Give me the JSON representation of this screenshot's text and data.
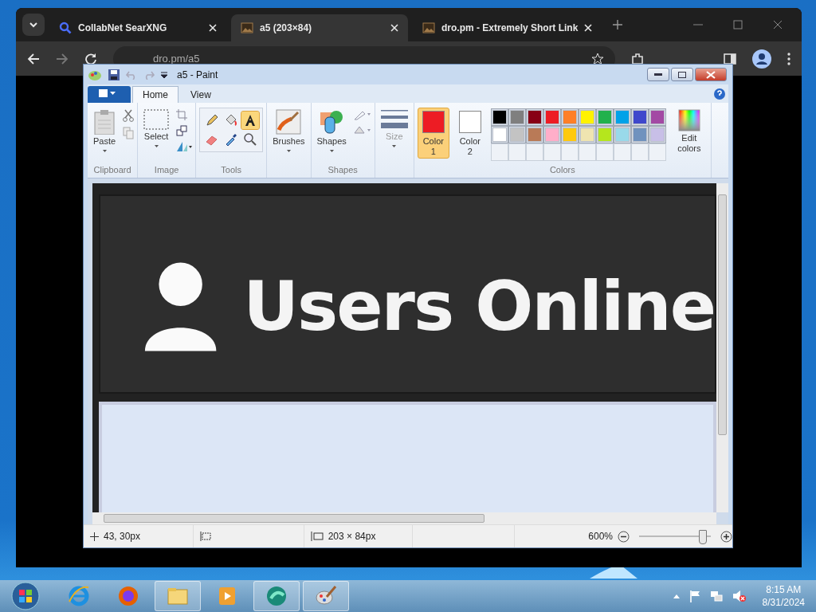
{
  "browser": {
    "tabs": [
      {
        "title": "CollabNet SearXNG",
        "kind": "search",
        "selected": false
      },
      {
        "title": "a5 (203×84)",
        "kind": "image",
        "selected": true
      },
      {
        "title": "dro.pm - Extremely Short Link",
        "kind": "image",
        "selected": false
      }
    ],
    "address": "dro.pm/a5"
  },
  "paint": {
    "title": "a5 - Paint",
    "ribbon_tabs": [
      {
        "label": "Home",
        "selected": true
      },
      {
        "label": "View",
        "selected": false
      }
    ],
    "group_labels": {
      "clipboard": "Clipboard",
      "image": "Image",
      "tools": "Tools",
      "shapes": "Shapes",
      "colors": "Colors"
    },
    "buttons": {
      "paste": "Paste",
      "select": "Select",
      "brushes": "Brushes",
      "shapes": "Shapes",
      "size": "Size",
      "edit_colors": "Edit colors"
    },
    "tools": [
      {
        "kind": "pencil",
        "selected": false
      },
      {
        "kind": "fill",
        "selected": false
      },
      {
        "kind": "text",
        "selected": true
      },
      {
        "kind": "eraser",
        "selected": false
      },
      {
        "kind": "picker",
        "selected": false
      },
      {
        "kind": "magnifier",
        "selected": false
      }
    ],
    "color_slots": [
      {
        "label": "Color 1",
        "color": "#ed1c24",
        "selected": true
      },
      {
        "label": "Color 2",
        "color": "#ffffff",
        "selected": false
      }
    ],
    "palette": [
      {
        "color": "#000000"
      },
      {
        "color": "#7f7f7f"
      },
      {
        "color": "#880015"
      },
      {
        "color": "#ed1c24"
      },
      {
        "color": "#ff7f27"
      },
      {
        "color": "#fff200"
      },
      {
        "color": "#22b14c"
      },
      {
        "color": "#00a2e8"
      },
      {
        "color": "#3f48cc"
      },
      {
        "color": "#a349a4"
      },
      {
        "color": "#ffffff"
      },
      {
        "color": "#c3c3c3"
      },
      {
        "color": "#b97a57"
      },
      {
        "color": "#ffaec9"
      },
      {
        "color": "#ffc90e"
      },
      {
        "color": "#efe4b0"
      },
      {
        "color": "#b5e61d"
      },
      {
        "color": "#99d9ea"
      },
      {
        "color": "#7092be"
      },
      {
        "color": "#c8bfe7"
      }
    ],
    "canvas": {
      "heading": "Users Online"
    },
    "status": {
      "position": "43, 30px",
      "size": "203 × 84px",
      "zoom": "600%",
      "zoom_slider": {
        "level": 0.88
      }
    }
  },
  "taskbar": {
    "apps": [
      {
        "kind": "ie",
        "selected": false
      },
      {
        "kind": "firefox",
        "selected": false
      },
      {
        "kind": "explorer",
        "selected": true
      },
      {
        "kind": "media",
        "selected": false
      },
      {
        "kind": "green",
        "selected": true
      },
      {
        "kind": "paint",
        "selected": true
      }
    ],
    "time": "8:15 AM",
    "date": "8/31/2024"
  }
}
